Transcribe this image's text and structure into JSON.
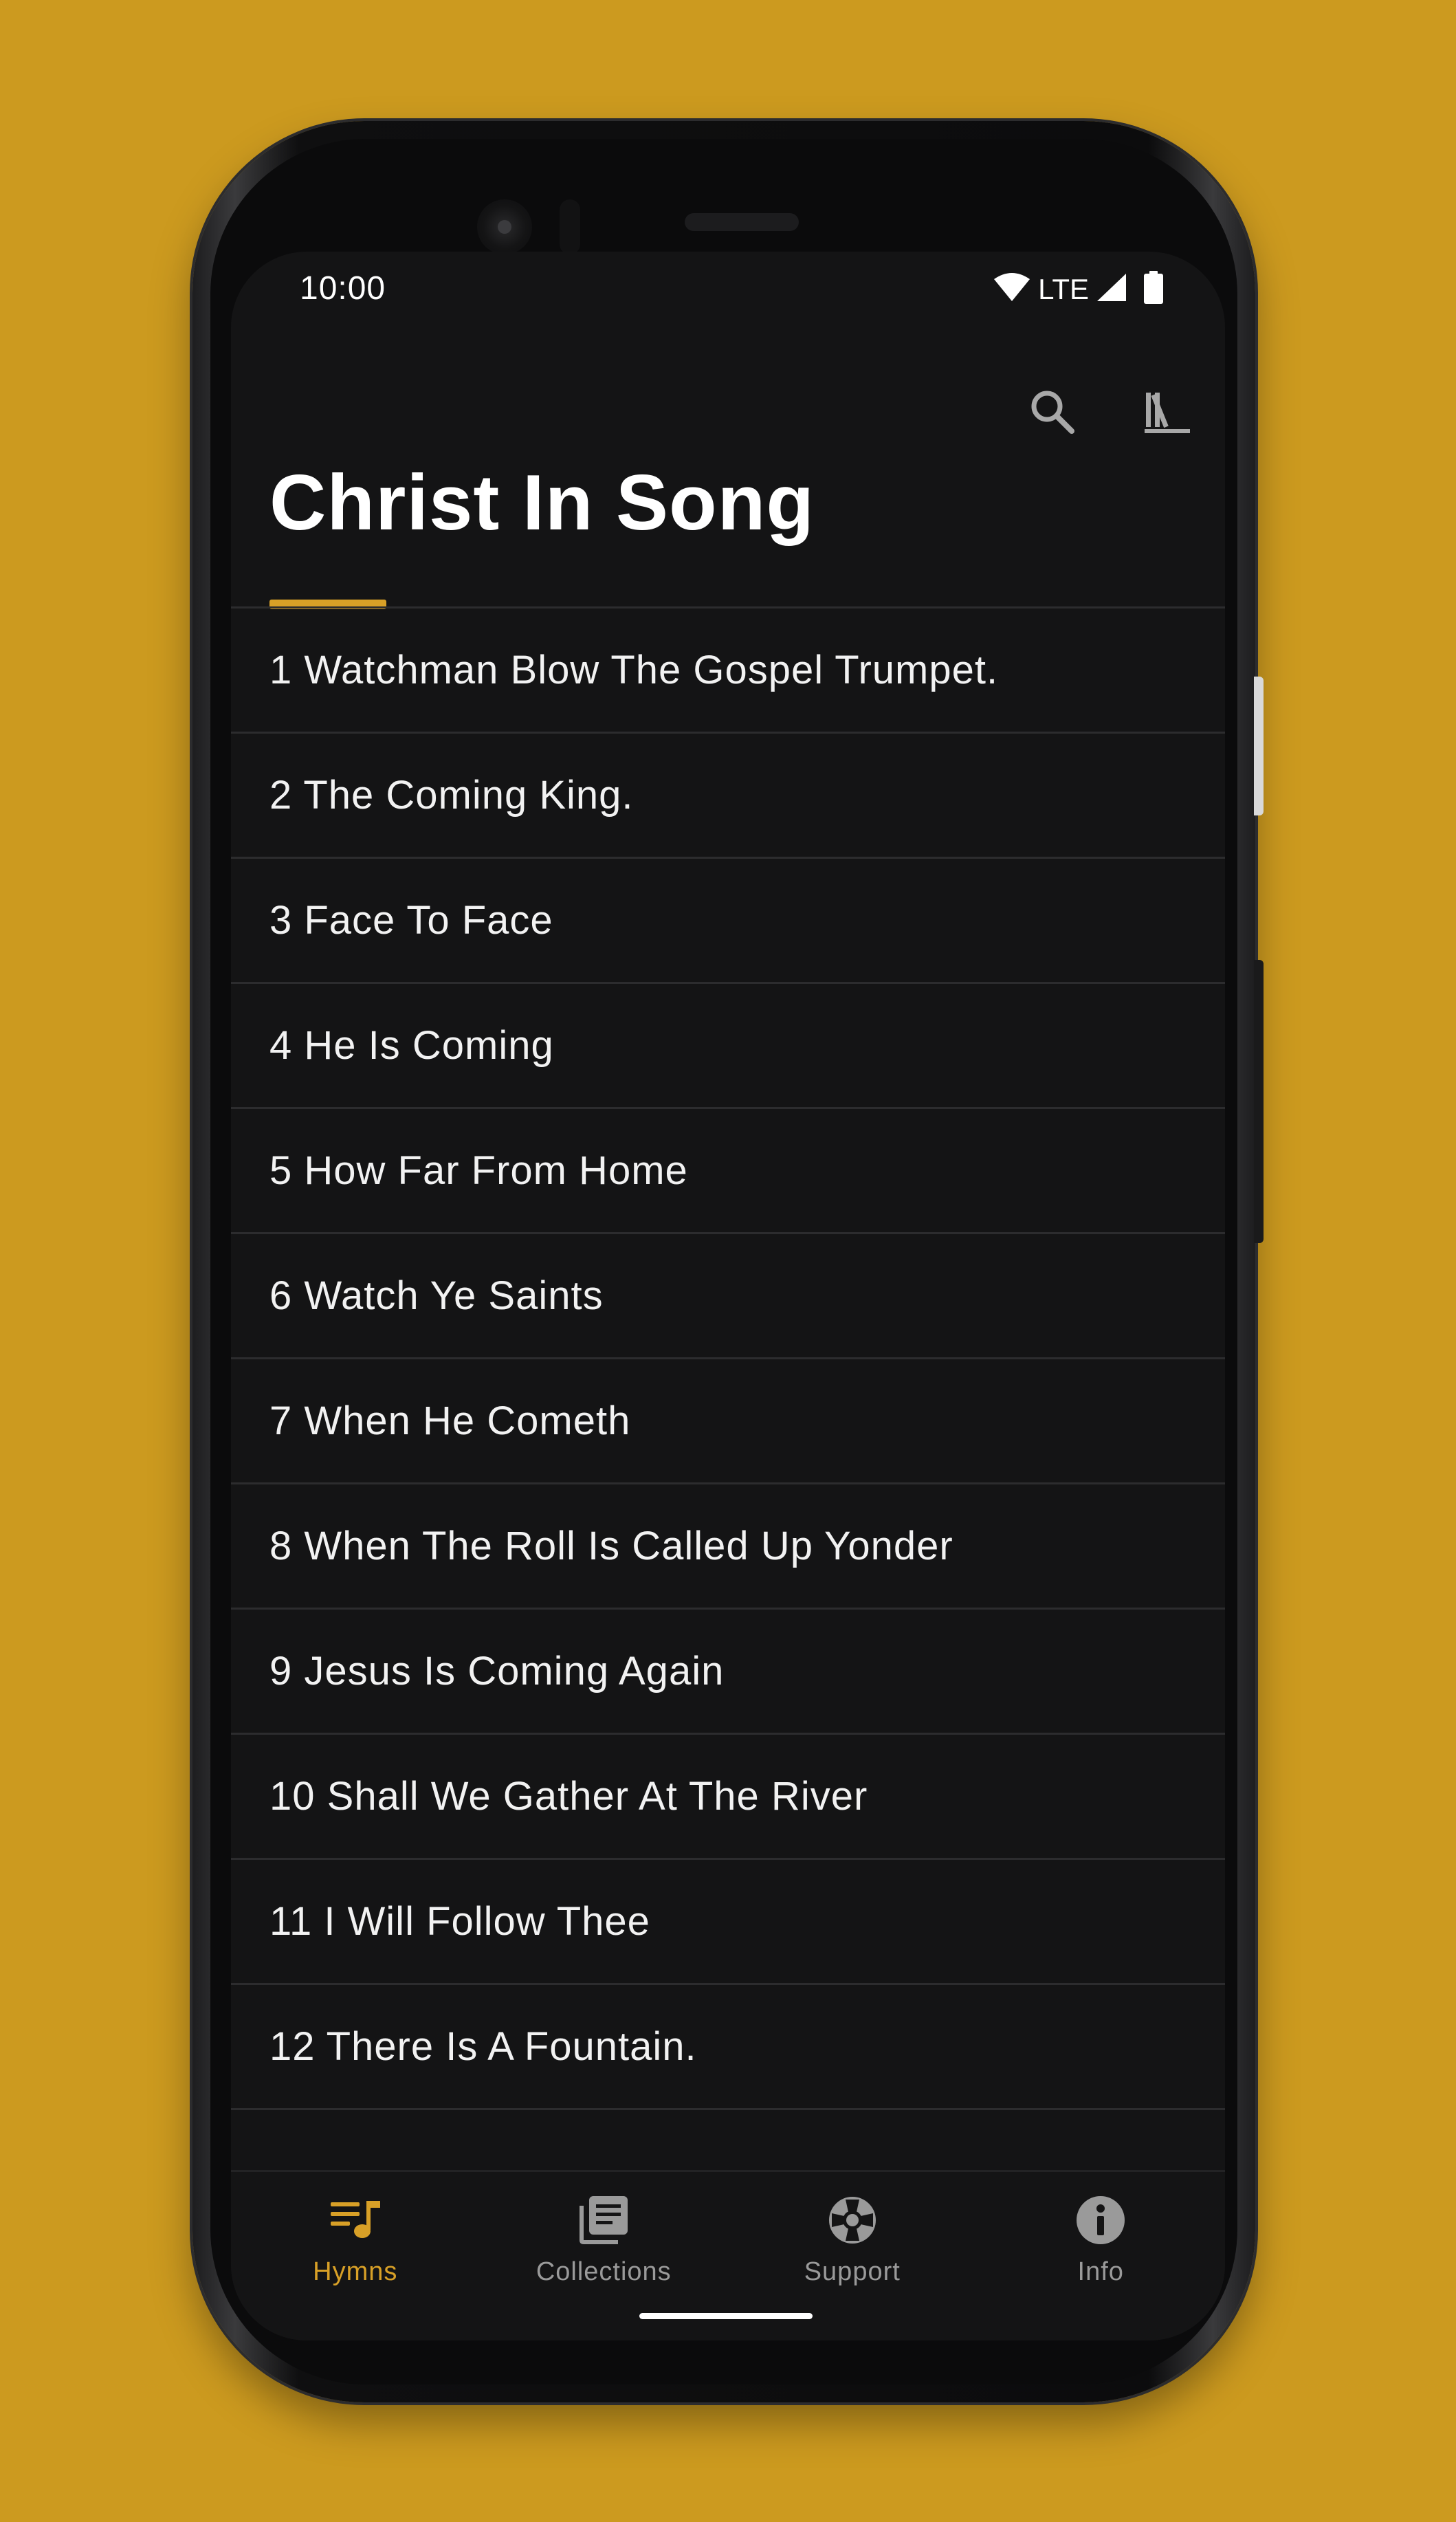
{
  "status_bar": {
    "time": "10:00",
    "network": "LTE"
  },
  "header": {
    "title": "Christ In Song",
    "actions": [
      {
        "icon": "search-icon"
      },
      {
        "icon": "library-icon"
      }
    ]
  },
  "hymns": [
    {
      "label": "1 Watchman Blow The Gospel Trumpet."
    },
    {
      "label": "2 The Coming King."
    },
    {
      "label": "3 Face To Face"
    },
    {
      "label": "4 He Is Coming"
    },
    {
      "label": "5 How Far From Home"
    },
    {
      "label": "6 Watch Ye Saints"
    },
    {
      "label": "7 When He Cometh"
    },
    {
      "label": "8 When The Roll Is Called Up Yonder"
    },
    {
      "label": "9 Jesus Is Coming Again"
    },
    {
      "label": "10 Shall We Gather At The River"
    },
    {
      "label": "11 I Will Follow Thee"
    },
    {
      "label": "12 There Is A Fountain."
    }
  ],
  "bottom_nav": {
    "items": [
      {
        "label": "Hymns",
        "icon": "hymns-icon",
        "active": true
      },
      {
        "label": "Collections",
        "icon": "collections-icon",
        "active": false
      },
      {
        "label": "Support",
        "icon": "support-icon",
        "active": false
      },
      {
        "label": "Info",
        "icon": "info-icon",
        "active": false
      }
    ]
  },
  "colors": {
    "background": "#cc9a1f",
    "screen": "#141415",
    "accent": "#d8a027",
    "divider": "#2c2c2e",
    "inactive": "#9a9a9a"
  }
}
